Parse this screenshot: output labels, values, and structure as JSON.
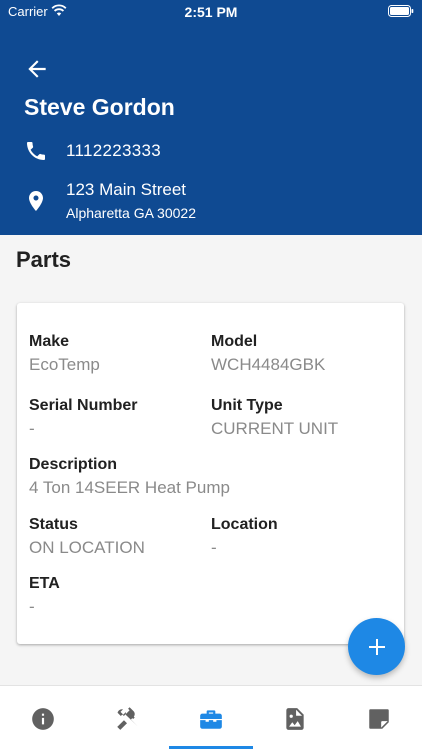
{
  "status_bar": {
    "carrier": "Carrier",
    "time": "2:51 PM"
  },
  "header": {
    "name": "Steve Gordon",
    "phone": "1112223333",
    "address_line1": "123 Main Street",
    "address_line2": "Alpharetta GA 30022"
  },
  "section": {
    "title": "Parts"
  },
  "part": {
    "make": {
      "label": "Make",
      "value": "EcoTemp"
    },
    "model": {
      "label": "Model",
      "value": "WCH4484GBK"
    },
    "serial": {
      "label": "Serial Number",
      "value": "-"
    },
    "unit_type": {
      "label": "Unit Type",
      "value": "CURRENT UNIT"
    },
    "description": {
      "label": "Description",
      "value": "4 Ton 14SEER Heat Pump"
    },
    "status": {
      "label": "Status",
      "value": "ON LOCATION"
    },
    "location": {
      "label": "Location",
      "value": "-"
    },
    "eta": {
      "label": "ETA",
      "value": "-"
    }
  },
  "bottom_nav": {
    "items": [
      {
        "icon": "info-icon"
      },
      {
        "icon": "tools-icon"
      },
      {
        "icon": "toolbox-icon",
        "active": true
      },
      {
        "icon": "photo-icon"
      },
      {
        "icon": "note-icon"
      }
    ]
  },
  "colors": {
    "header": "#0f4a92",
    "accent": "#1e88e5",
    "nav_icon": "#616161",
    "nav_active": "#1e88e5"
  }
}
